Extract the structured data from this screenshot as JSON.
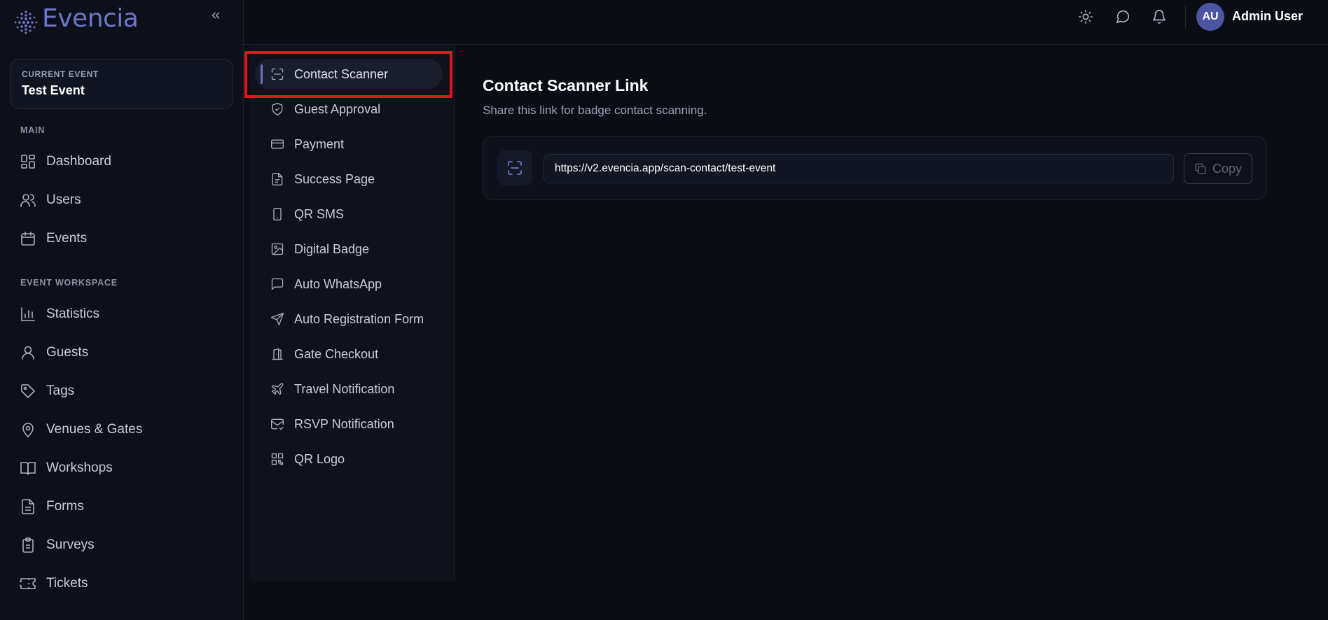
{
  "brand": {
    "name": "Evencia"
  },
  "sidebar": {
    "current_event_label": "CURRENT EVENT",
    "current_event_name": "Test Event",
    "sections": [
      {
        "title": "MAIN",
        "items": [
          {
            "label": "Dashboard",
            "icon": "dashboard-icon"
          },
          {
            "label": "Users",
            "icon": "users-icon"
          },
          {
            "label": "Events",
            "icon": "calendar-icon"
          }
        ]
      },
      {
        "title": "EVENT WORKSPACE",
        "items": [
          {
            "label": "Statistics",
            "icon": "bar-chart-icon"
          },
          {
            "label": "Guests",
            "icon": "user-icon"
          },
          {
            "label": "Tags",
            "icon": "tag-icon"
          },
          {
            "label": "Venues & Gates",
            "icon": "map-pin-icon"
          },
          {
            "label": "Workshops",
            "icon": "book-icon"
          },
          {
            "label": "Forms",
            "icon": "file-text-icon"
          },
          {
            "label": "Surveys",
            "icon": "clipboard-icon"
          },
          {
            "label": "Tickets",
            "icon": "ticket-icon"
          }
        ]
      }
    ]
  },
  "topbar": {
    "user_initials": "AU",
    "user_name": "Admin User"
  },
  "submenu": {
    "active_index": 0,
    "items": [
      {
        "label": "Contact Scanner",
        "icon": "scan-icon"
      },
      {
        "label": "Guest Approval",
        "icon": "shield-check-icon"
      },
      {
        "label": "Payment",
        "icon": "credit-card-icon"
      },
      {
        "label": "Success Page",
        "icon": "file-icon"
      },
      {
        "label": "QR SMS",
        "icon": "phone-icon"
      },
      {
        "label": "Digital Badge",
        "icon": "image-icon"
      },
      {
        "label": "Auto WhatsApp",
        "icon": "message-square-icon"
      },
      {
        "label": "Auto Registration Form",
        "icon": "send-icon"
      },
      {
        "label": "Gate Checkout",
        "icon": "door-icon"
      },
      {
        "label": "Travel Notification",
        "icon": "plane-icon"
      },
      {
        "label": "RSVP Notification",
        "icon": "mail-check-icon"
      },
      {
        "label": "QR Logo",
        "icon": "qr-code-icon"
      }
    ]
  },
  "main": {
    "title": "Contact Scanner Link",
    "subtitle": "Share this link for badge contact scanning.",
    "link_value": "https://v2.evencia.app/scan-contact/test-event",
    "copy_label": "Copy"
  },
  "colors": {
    "accent": "#6c76c8",
    "highlight": "#e0161b",
    "avatar_bg": "#4b55a3"
  }
}
